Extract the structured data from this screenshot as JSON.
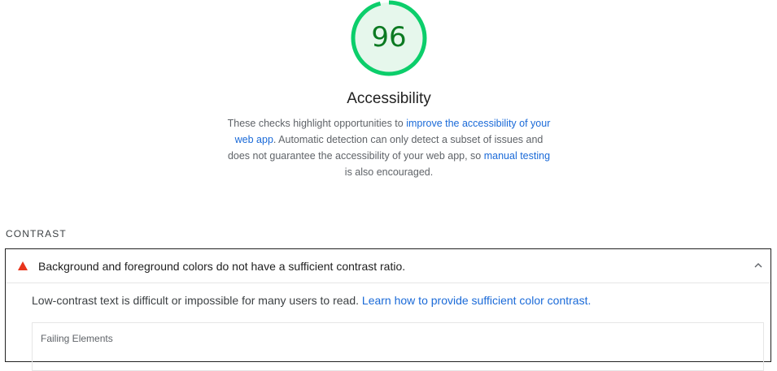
{
  "category": {
    "score": "96",
    "score_value": 96,
    "title": "Accessibility",
    "description": {
      "part1": "These checks highlight opportunities to ",
      "link1": "improve the accessibility of your web app",
      "part2": ". Automatic detection can only detect a subset of issues and does not guarantee the accessibility of your web app, so ",
      "link2": "manual testing",
      "part3": " is also encouraged."
    },
    "colors": {
      "gauge_stroke": "#0cce6b",
      "gauge_fill": "#e6f7ec",
      "score_text": "#0c7a22",
      "link": "#1a6ad8",
      "warning": "#e8341c"
    }
  },
  "section": {
    "heading": "CONTRAST"
  },
  "audit": {
    "icon": "warning-triangle-icon",
    "title": "Background and foreground colors do not have a sufficient contrast ratio.",
    "expanded_icon": "chevron-up-icon",
    "body_text": "Low-contrast text is difficult or impossible for many users to read. ",
    "body_link": "Learn how to provide sufficient color contrast.",
    "failing_label": "Failing Elements"
  }
}
